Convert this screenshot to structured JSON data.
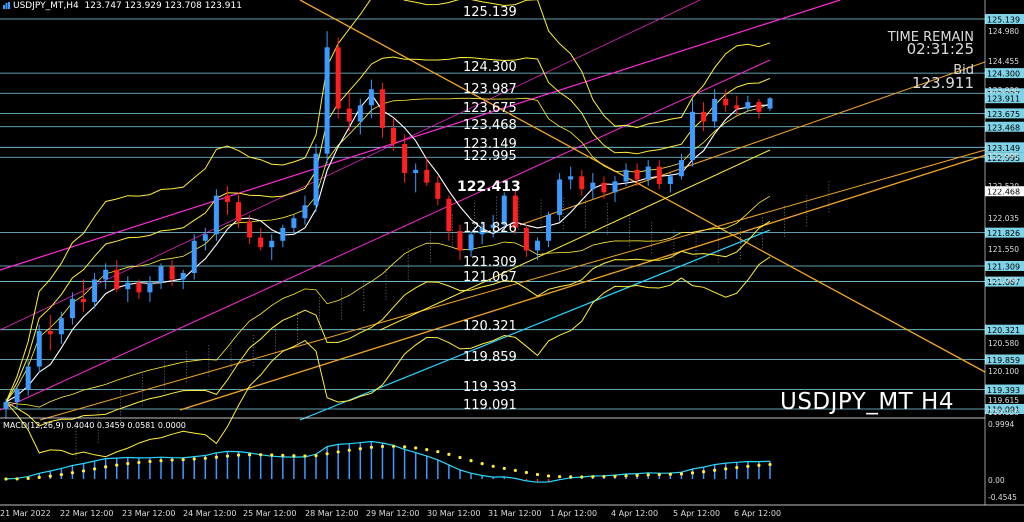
{
  "header": {
    "symbol": "USDJPY_MT,H4",
    "ohlc": "123.747 123.929 123.708 123.911"
  },
  "info_panel": {
    "time_remain_label": "TIME REMAIN",
    "time_remain": "02:31:25",
    "bid_label": "Bid",
    "bid": "123.911"
  },
  "watermark": "USDJPY_MT H4",
  "macd_header": "MACD(12,26,9) 0.4040 0.3459 0.0581 0.0000",
  "colors": {
    "background": "#000000",
    "bull": "#3d9bff",
    "bear": "#ff1f1f",
    "level_line": "#7fd3e6",
    "yellow": "#ffef3a",
    "magenta": "#ff2bd6",
    "cyan": "#27d7ff",
    "white": "#ffffff",
    "orange": "#f2a623"
  },
  "levels": [
    {
      "price": 125.139,
      "text": "125.139"
    },
    {
      "price": 124.3,
      "text": "124.300"
    },
    {
      "price": 123.987,
      "text": "123.987"
    },
    {
      "price": 123.675,
      "text": "123.675"
    },
    {
      "price": 123.468,
      "text": "123.468"
    },
    {
      "price": 123.149,
      "text": "123.149"
    },
    {
      "price": 122.995,
      "text": "122.995"
    },
    {
      "price": 121.826,
      "text": "121.826"
    },
    {
      "price": 121.309,
      "text": "121.309"
    },
    {
      "price": 121.067,
      "text": "121.067"
    },
    {
      "price": 120.321,
      "text": "120.321"
    },
    {
      "price": 119.859,
      "text": "119.859"
    },
    {
      "price": 119.393,
      "text": "119.393"
    },
    {
      "price": 119.091,
      "text": "119.091"
    }
  ],
  "overlap_text": "122.413",
  "price_ticks": [
    "124.980",
    "124.455",
    "123.930",
    "122.995",
    "122.520",
    "122.035",
    "121.550",
    "121.065",
    "120.580",
    "120.100",
    "119.615",
    "119.125"
  ],
  "price_tags": [
    {
      "price": 123.911,
      "text": "123.911"
    },
    {
      "price": 122.468,
      "text": "122.468"
    }
  ],
  "macd_ticks": [
    "0.9994",
    "0.00",
    "-0.4545"
  ],
  "time_labels": [
    "21 Mar 2022",
    "22 Mar 12:00",
    "23 Mar 12:00",
    "24 Mar 12:00",
    "25 Mar 12:00",
    "28 Mar 12:00",
    "29 Mar 12:00",
    "30 Mar 12:00",
    "31 Mar 12:00",
    "1 Apr 12:00",
    "4 Apr 12:00",
    "5 Apr 12:00",
    "6 Apr 12:00"
  ],
  "candles": [
    [
      119.1,
      119.25,
      118.95,
      119.2
    ],
    [
      119.2,
      119.45,
      119.1,
      119.4
    ],
    [
      119.4,
      119.85,
      119.3,
      119.75
    ],
    [
      119.75,
      120.4,
      119.65,
      120.3
    ],
    [
      120.3,
      120.55,
      120.0,
      120.25
    ],
    [
      120.25,
      120.6,
      120.1,
      120.5
    ],
    [
      120.5,
      120.9,
      120.4,
      120.8
    ],
    [
      120.8,
      121.1,
      120.6,
      120.75
    ],
    [
      120.75,
      121.2,
      120.65,
      121.1
    ],
    [
      121.1,
      121.35,
      120.95,
      121.25
    ],
    [
      121.25,
      121.4,
      120.9,
      120.95
    ],
    [
      120.95,
      121.15,
      120.75,
      121.05
    ],
    [
      121.05,
      121.1,
      120.8,
      120.9
    ],
    [
      120.9,
      121.15,
      120.75,
      121.05
    ],
    [
      121.05,
      121.35,
      120.95,
      121.3
    ],
    [
      121.3,
      121.4,
      121.0,
      121.1
    ],
    [
      121.1,
      121.25,
      120.95,
      121.2
    ],
    [
      121.2,
      121.8,
      121.1,
      121.7
    ],
    [
      121.7,
      121.9,
      121.55,
      121.8
    ],
    [
      121.8,
      122.5,
      121.7,
      122.4
    ],
    [
      122.4,
      122.55,
      122.1,
      122.3
    ],
    [
      122.3,
      122.45,
      121.9,
      122.0
    ],
    [
      122.0,
      122.1,
      121.65,
      121.75
    ],
    [
      121.75,
      121.9,
      121.55,
      121.6
    ],
    [
      121.6,
      121.8,
      121.4,
      121.7
    ],
    [
      121.7,
      121.95,
      121.6,
      121.9
    ],
    [
      121.9,
      122.1,
      121.8,
      122.05
    ],
    [
      122.05,
      122.4,
      121.95,
      122.25
    ],
    [
      122.25,
      123.2,
      122.15,
      123.05
    ],
    [
      123.05,
      124.95,
      122.9,
      124.7
    ],
    [
      124.7,
      124.85,
      123.6,
      123.75
    ],
    [
      123.75,
      124.0,
      123.4,
      123.55
    ],
    [
      123.55,
      123.9,
      123.35,
      123.8
    ],
    [
      123.8,
      124.2,
      123.6,
      124.05
    ],
    [
      124.05,
      124.15,
      123.3,
      123.45
    ],
    [
      123.45,
      123.6,
      123.1,
      123.2
    ],
    [
      123.2,
      123.35,
      122.6,
      122.75
    ],
    [
      122.75,
      122.9,
      122.45,
      122.8
    ],
    [
      122.8,
      123.0,
      122.55,
      122.6
    ],
    [
      122.6,
      122.7,
      122.25,
      122.35
    ],
    [
      122.35,
      122.4,
      121.7,
      121.85
    ],
    [
      121.85,
      121.95,
      121.4,
      121.55
    ],
    [
      121.55,
      121.85,
      121.45,
      121.8
    ],
    [
      121.8,
      122.0,
      121.65,
      121.9
    ],
    [
      121.9,
      122.1,
      121.75,
      121.95
    ],
    [
      121.95,
      122.45,
      121.85,
      122.4
    ],
    [
      122.4,
      122.5,
      121.8,
      121.9
    ],
    [
      121.9,
      121.95,
      121.45,
      121.55
    ],
    [
      121.55,
      121.75,
      121.4,
      121.7
    ],
    [
      121.7,
      122.15,
      121.6,
      122.1
    ],
    [
      122.1,
      122.75,
      122.0,
      122.65
    ],
    [
      122.65,
      122.85,
      122.5,
      122.7
    ],
    [
      122.7,
      122.8,
      122.4,
      122.5
    ],
    [
      122.5,
      122.75,
      122.35,
      122.6
    ],
    [
      122.6,
      122.7,
      122.35,
      122.45
    ],
    [
      122.45,
      122.7,
      122.3,
      122.62
    ],
    [
      122.62,
      122.9,
      122.55,
      122.8
    ],
    [
      122.8,
      122.9,
      122.55,
      122.65
    ],
    [
      122.65,
      122.95,
      122.55,
      122.85
    ],
    [
      122.85,
      122.95,
      122.5,
      122.58
    ],
    [
      122.58,
      122.75,
      122.45,
      122.7
    ],
    [
      122.7,
      123.05,
      122.65,
      122.95
    ],
    [
      122.95,
      123.9,
      122.85,
      123.7
    ],
    [
      123.7,
      123.85,
      123.4,
      123.55
    ],
    [
      123.55,
      124.05,
      123.45,
      123.9
    ],
    [
      123.9,
      124.05,
      123.7,
      123.8
    ],
    [
      123.8,
      123.95,
      123.65,
      123.75
    ],
    [
      123.75,
      123.95,
      123.7,
      123.85
    ],
    [
      123.85,
      123.9,
      123.6,
      123.7
    ],
    [
      123.75,
      123.93,
      123.71,
      123.91
    ]
  ]
}
